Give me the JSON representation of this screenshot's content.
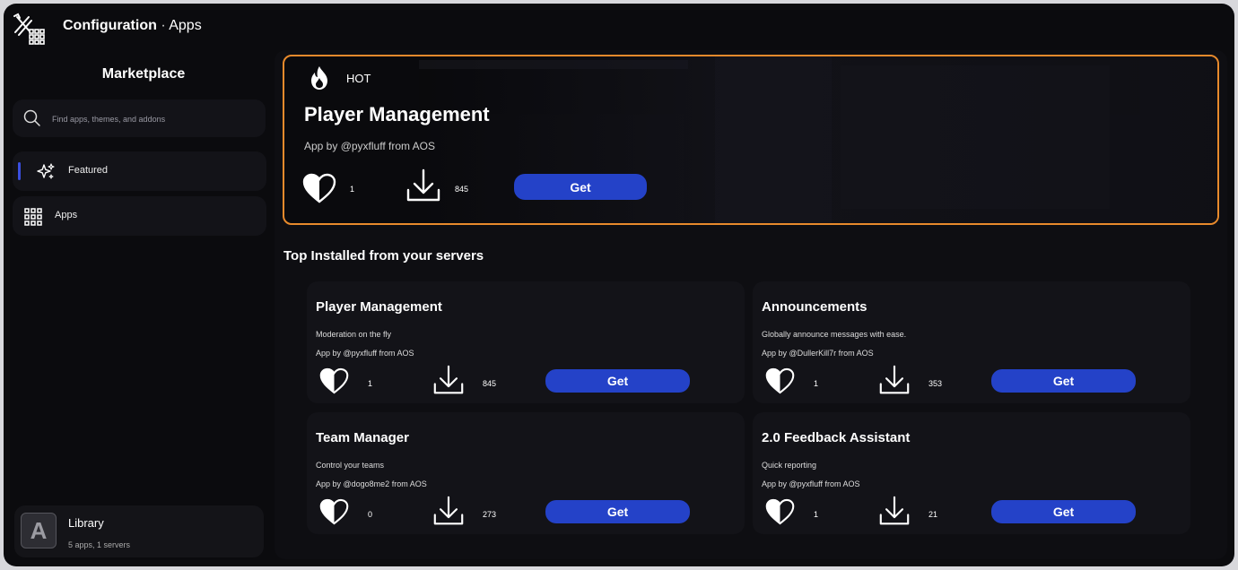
{
  "header": {
    "section": "Configuration",
    "separator": "·",
    "page": "Apps"
  },
  "sidebar": {
    "title": "Marketplace",
    "search_placeholder": "Find apps, themes, and addons",
    "items": [
      {
        "label": "Featured",
        "icon": "sparkles-icon",
        "active": true
      },
      {
        "label": "Apps",
        "icon": "grid-icon",
        "active": false
      }
    ],
    "library": {
      "avatar_letter": "A",
      "title": "Library",
      "subtitle": "5 apps, 1 servers"
    }
  },
  "hero": {
    "badge": "HOT",
    "badge_icon": "flame-icon",
    "title": "Player Management",
    "author": "App by @pyxfluff from AOS",
    "likes": "1",
    "downloads": "845",
    "get_label": "Get",
    "accent": "#e88a2c"
  },
  "top_installed": {
    "title": "Top Installed from your servers",
    "apps": [
      {
        "name": "Player Management",
        "description": "Moderation on the fly",
        "author": "App by @pyxfluff from AOS",
        "likes": "1",
        "downloads": "845",
        "get_label": "Get"
      },
      {
        "name": "Announcements",
        "description": "Globally announce messages with ease.",
        "author": "App by @DullerKill7r from AOS",
        "likes": "1",
        "downloads": "353",
        "get_label": "Get"
      },
      {
        "name": "Team Manager",
        "description": "Control your teams",
        "author": "App by @dogo8me2 from AOS",
        "likes": "0",
        "downloads": "273",
        "get_label": "Get"
      },
      {
        "name": "2.0 Feedback Assistant",
        "description": "Quick reporting",
        "author": "App by @pyxfluff from AOS",
        "likes": "1",
        "downloads": "21",
        "get_label": "Get"
      }
    ]
  },
  "colors": {
    "button": "#2442c8",
    "active_indicator": "#3a4fe0",
    "background": "#0b0b0e"
  }
}
